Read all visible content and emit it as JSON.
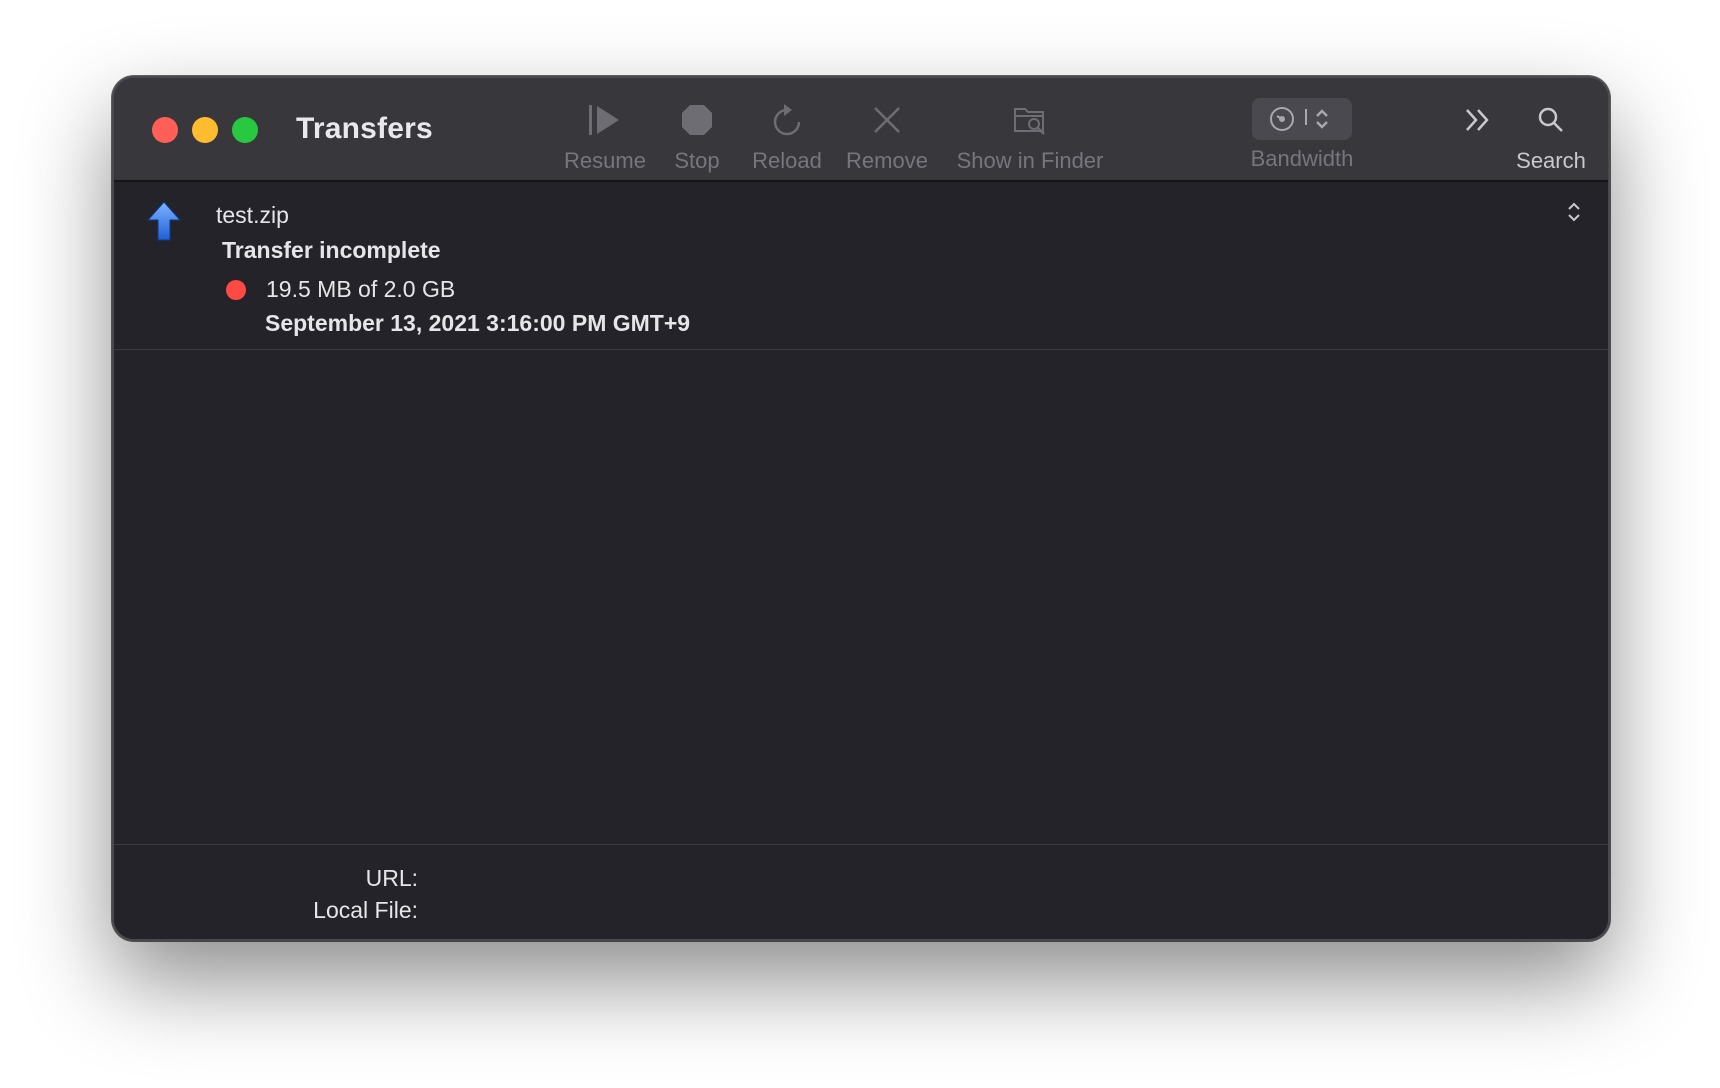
{
  "window": {
    "title": "Transfers"
  },
  "toolbar": {
    "items": [
      {
        "label": "Resume",
        "icon": "play-icon"
      },
      {
        "label": "Stop",
        "icon": "stop-icon"
      },
      {
        "label": "Reload",
        "icon": "reload-icon"
      },
      {
        "label": "Remove",
        "icon": "close-x-icon"
      },
      {
        "label": "Show in Finder",
        "icon": "folder-search-icon"
      },
      {
        "label": "Bandwidth",
        "icon": "gauge-icon"
      },
      {
        "label": "",
        "icon": "chevron-double-right-icon"
      },
      {
        "label": "Search",
        "icon": "search-icon"
      }
    ]
  },
  "transfer": {
    "file_name": "test.zip",
    "status": "Transfer incomplete",
    "size": "19.5 MB of 2.0 GB",
    "date": "September 13, 2021 3:16:00 PM GMT+9",
    "status_color": "#ff4a44",
    "direction_icon": "upload-arrow-icon"
  },
  "info": {
    "url_label": "URL:",
    "local_file_label": "Local File:"
  },
  "colors": {
    "background": "#242329",
    "toolbar": "#38373c",
    "close": "#ff5f57",
    "minimize": "#febc2e",
    "maximize": "#28c840"
  }
}
